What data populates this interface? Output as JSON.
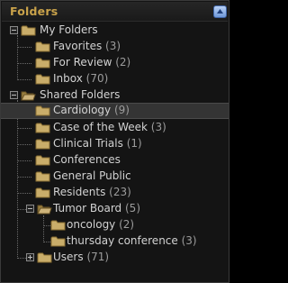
{
  "panel": {
    "title": "Folders"
  },
  "tree": {
    "my_folders": {
      "label": "My Folders"
    },
    "favorites": {
      "label": "Favorites",
      "count": "(3)"
    },
    "for_review": {
      "label": "For Review",
      "count": "(2)"
    },
    "inbox": {
      "label": "Inbox",
      "count": "(70)"
    },
    "shared_folders": {
      "label": "Shared Folders"
    },
    "cardiology": {
      "label": "Cardiology",
      "count": "(9)"
    },
    "case_of_week": {
      "label": "Case of the Week",
      "count": "(3)"
    },
    "clinical_trials": {
      "label": "Clinical Trials",
      "count": "(1)"
    },
    "conferences": {
      "label": "Conferences"
    },
    "general_public": {
      "label": "General Public"
    },
    "residents": {
      "label": "Residents",
      "count": "(23)"
    },
    "tumor_board": {
      "label": "Tumor Board",
      "count": "(5)"
    },
    "oncology": {
      "label": "oncology",
      "count": "(2)"
    },
    "thursday_conference": {
      "label": "thursday conference",
      "count": "(3)"
    },
    "users": {
      "label": "Users",
      "count": "(71)"
    }
  },
  "colors": {
    "title": "#c9a24a",
    "folder_fill": "#c9ad6a",
    "folder_dark": "#9a7f3f",
    "label": "#d2d2d2",
    "count": "#9c9c9c",
    "selection": "#343434"
  },
  "icons": {
    "collapse": "up-arrow-icon",
    "folder": "folder-icon",
    "open_folder": "folder-open-icon",
    "expand": "plus-box-icon",
    "collapse_node": "minus-box-icon"
  }
}
